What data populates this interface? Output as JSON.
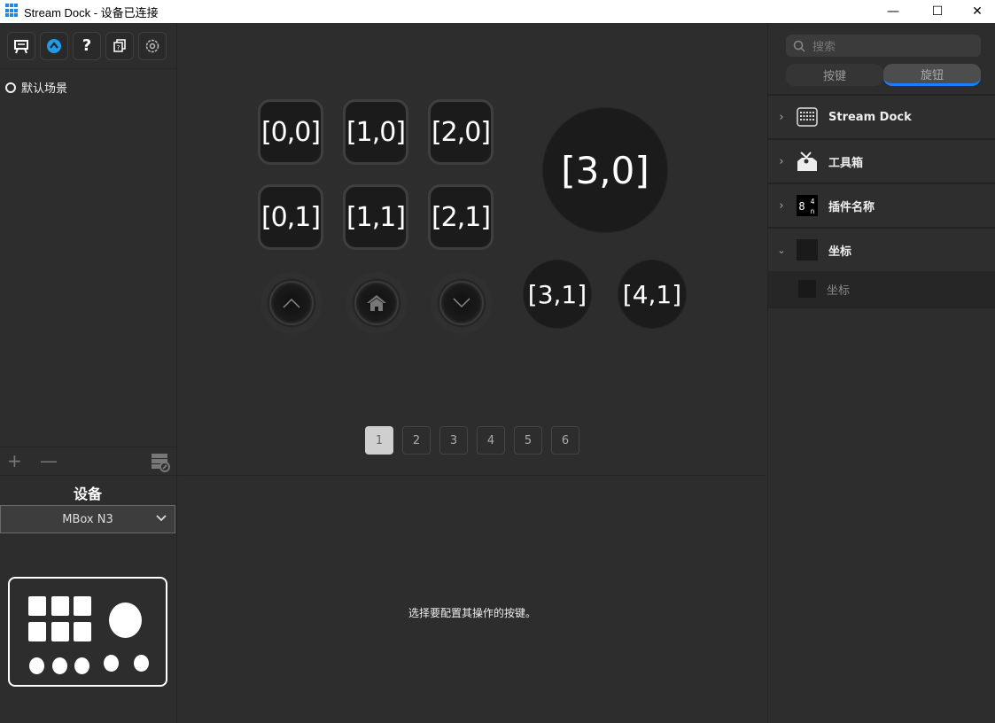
{
  "window": {
    "title": "Stream Dock - 设备已连接",
    "minimize_label": "—",
    "maximize_label": "☐",
    "close_label": "✕"
  },
  "left": {
    "toolbar": [
      {
        "name": "presentation-icon",
        "glyph": "⌸"
      },
      {
        "name": "app-store-icon",
        "glyph": "A"
      },
      {
        "name": "help-icon",
        "glyph": "?"
      },
      {
        "name": "copy-help-icon",
        "glyph": "⧉"
      },
      {
        "name": "settings-icon",
        "glyph": "⚙"
      }
    ],
    "scenes": [
      {
        "label": "默认场景"
      }
    ],
    "add_label": "+",
    "remove_label": "—",
    "device_label": "设备",
    "device_selected": "MBox N3"
  },
  "center": {
    "keys": [
      {
        "label": "[0,0]"
      },
      {
        "label": "[1,0]"
      },
      {
        "label": "[2,0]"
      },
      {
        "label": "[0,1]"
      },
      {
        "label": "[1,1]"
      },
      {
        "label": "[2,1]"
      }
    ],
    "knobs": [
      {
        "label": "[3,0]"
      },
      {
        "label": "[3,1]"
      },
      {
        "label": "[4,1]"
      }
    ],
    "nav_buttons": [
      {
        "name": "page-up-button",
        "icon": "chevron-up-icon",
        "glyph": "︿"
      },
      {
        "name": "home-button",
        "icon": "home-icon",
        "glyph": "⌂"
      },
      {
        "name": "page-down-button",
        "icon": "chevron-down-icon",
        "glyph": "﹀"
      }
    ],
    "pages": [
      "1",
      "2",
      "3",
      "4",
      "5",
      "6"
    ],
    "active_page": "1",
    "hint": "选择要配置其操作的按键。"
  },
  "right": {
    "search_placeholder": "搜索",
    "tabs": [
      {
        "label": "按键",
        "active": false
      },
      {
        "label": "旋钮",
        "active": true
      }
    ],
    "categories": [
      {
        "label": "Stream Dock",
        "expanded": false,
        "icon": "grid-keypad-icon"
      },
      {
        "label": "工具箱",
        "expanded": false,
        "icon": "toolbox-icon"
      },
      {
        "label": "插件名称",
        "expanded": false,
        "icon": "digit-display-icon"
      },
      {
        "label": "坐标",
        "expanded": true,
        "icon": "blank-square-icon"
      }
    ],
    "subitems": [
      {
        "label": "坐标"
      }
    ],
    "accent": "#1a7fff"
  }
}
